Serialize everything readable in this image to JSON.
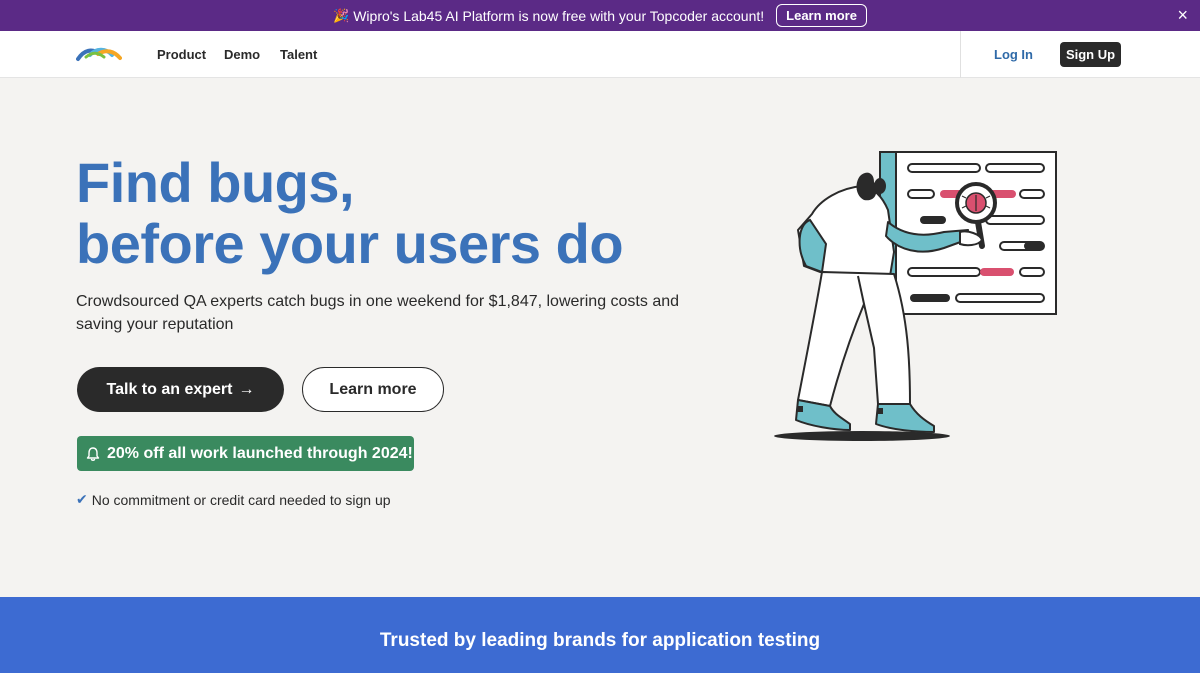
{
  "announcement": {
    "text": "Wipro's Lab45 AI Platform is now free with your Topcoder account!",
    "button": "Learn more",
    "party_icon": "🎉",
    "close_icon": "×"
  },
  "nav": {
    "items": [
      "Product",
      "Demo",
      "Talent"
    ],
    "login": "Log In",
    "signup": "Sign Up"
  },
  "hero": {
    "title_line1": "Find bugs,",
    "title_line2": "before your users do",
    "subtitle": "Crowdsourced QA experts catch bugs in one weekend for $1,847, lowering costs and saving your reputation",
    "primary_button": "Talk to an expert",
    "primary_button_arrow": "→",
    "secondary_button": "Learn more",
    "promo_icon": "bell-icon",
    "promo_text": "20% off all work launched through 2024!",
    "note_check": "✔",
    "note": "No commitment or credit card needed to sign up"
  },
  "trusted": {
    "text": "Trusted by leading brands for application testing"
  },
  "colors": {
    "announce_bg": "#5b2a86",
    "brand_blue": "#3b72b9",
    "promo_green": "#3a8a5f",
    "trusted_bg": "#3d6bd2",
    "dark": "#2a2a2a"
  }
}
